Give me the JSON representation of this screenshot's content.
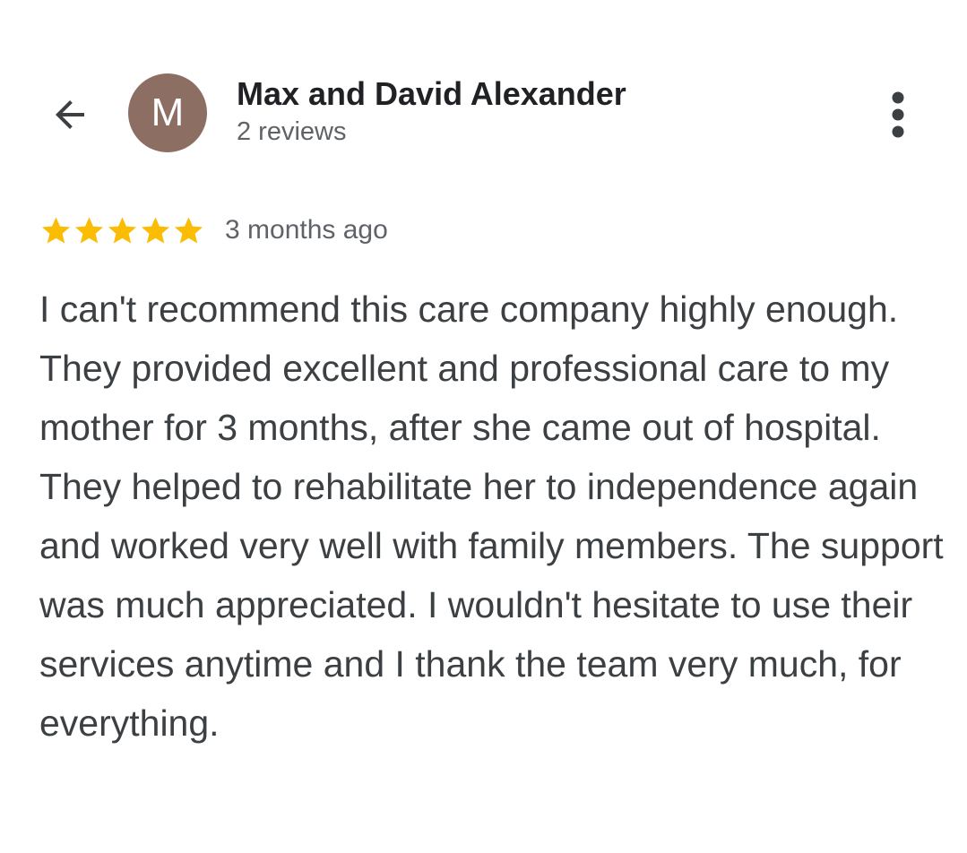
{
  "header": {
    "back_icon": "arrow-left-icon",
    "avatar_letter": "M",
    "avatar_color": "#8d6e63",
    "reviewer_name": "Max and David Alexander",
    "review_count": "2 reviews",
    "menu_icon": "more-vert-icon"
  },
  "review": {
    "rating": 5,
    "rating_max": 5,
    "star_color": "#fbbc04",
    "date": "3 months ago",
    "text": "I can't recommend this care company highly enough. They provided excellent and professional care to my mother for 3 months, after she came out of hospital. They helped to rehabilitate her to independence again and worked very well with family members. The support was much appreciated. I wouldn't hesitate to use their services anytime and I thank the team very much, for everything."
  }
}
